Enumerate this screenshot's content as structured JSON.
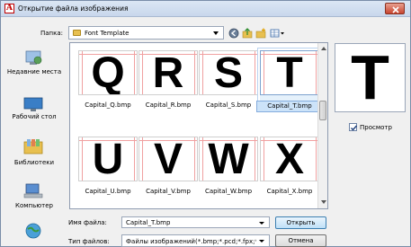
{
  "window": {
    "title": "Открытие файла изображения"
  },
  "toolbar": {
    "folder_label": "Папка:",
    "folder_name": "Font Template",
    "icons": [
      "back-icon",
      "up-folder-icon",
      "new-folder-icon",
      "views-menu-icon"
    ]
  },
  "places": [
    {
      "label": "Недавние места",
      "icon": "recent-places-icon"
    },
    {
      "label": "Рабочий стол",
      "icon": "desktop-icon"
    },
    {
      "label": "Библиотеки",
      "icon": "libraries-icon"
    },
    {
      "label": "Компьютер",
      "icon": "computer-icon"
    },
    {
      "label": "",
      "icon": "network-icon"
    }
  ],
  "files": [
    {
      "name": "Capital_Q.bmp",
      "letter": "Q",
      "selected": false
    },
    {
      "name": "Capital_R.bmp",
      "letter": "R",
      "selected": false
    },
    {
      "name": "Capital_S.bmp",
      "letter": "S",
      "selected": false
    },
    {
      "name": "Capital_T.bmp",
      "letter": "T",
      "selected": true
    },
    {
      "name": "Capital_U.bmp",
      "letter": "U",
      "selected": false
    },
    {
      "name": "Capital_V.bmp",
      "letter": "V",
      "selected": false
    },
    {
      "name": "Capital_W.bmp",
      "letter": "W",
      "selected": false
    },
    {
      "name": "Capital_X.bmp",
      "letter": "X",
      "selected": false
    }
  ],
  "preview": {
    "letter": "T",
    "checkbox_label": "Просмотр",
    "checked": true
  },
  "form": {
    "filename_label": "Имя файла:",
    "filename_value": "Capital_T.bmp",
    "filetype_label": "Тип файлов:",
    "filetype_value": "Файлы изображений(*.bmp;*.pcd;*.fpx;*.tif;*.g"
  },
  "buttons": {
    "open": "Открыть",
    "cancel": "Отмена"
  },
  "colors": {
    "selection": "#cce3f9",
    "close_button": "#c74530",
    "folder": "#e8c050"
  }
}
